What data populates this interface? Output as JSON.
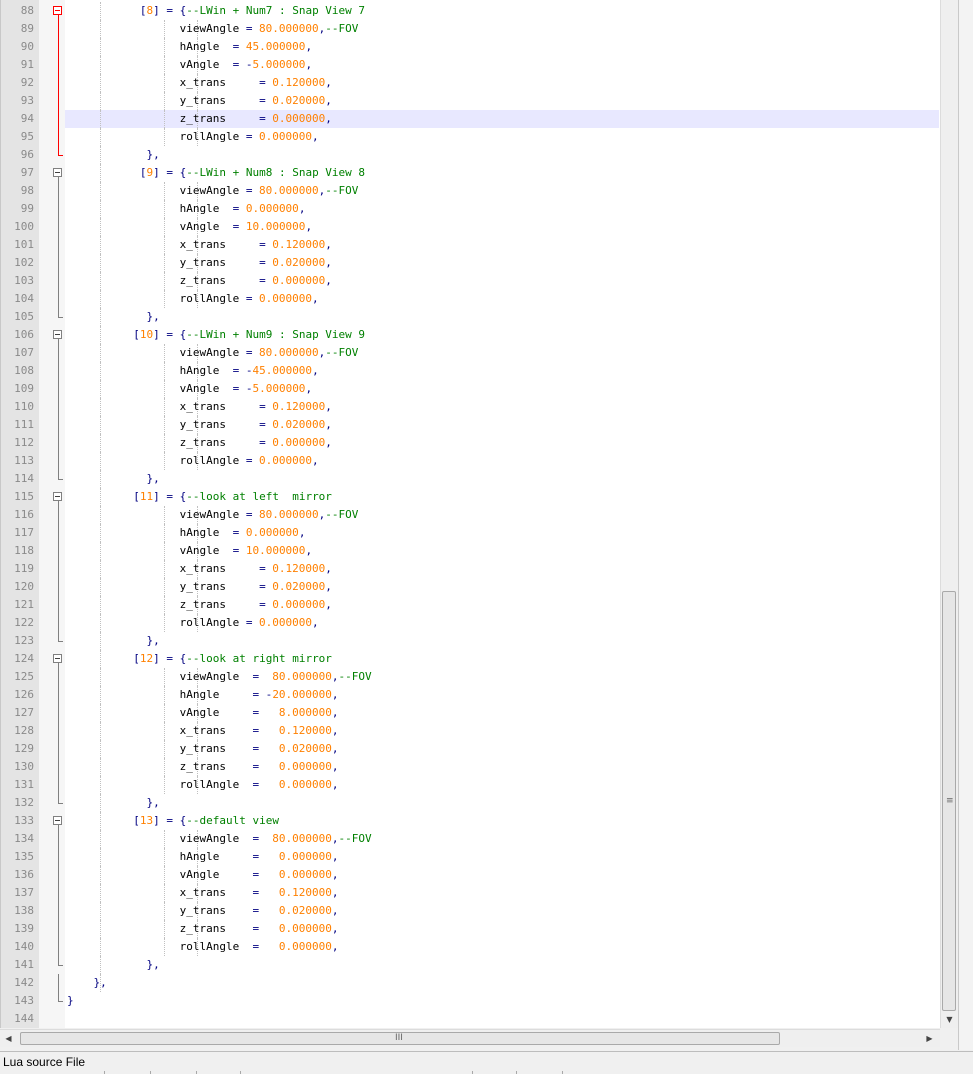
{
  "editor": {
    "current_line": 94,
    "lines": [
      {
        "num": "88",
        "fold": "box-red",
        "tokens": [
          [
            "",
            "          "
          ],
          [
            "k",
            " ["
          ],
          [
            "n",
            "8"
          ],
          [
            "k",
            "] = {"
          ],
          [
            "c",
            "--LWin + Num7 : Snap View 7"
          ]
        ]
      },
      {
        "num": "89",
        "fold": "line-red",
        "tokens": [
          [
            "",
            "                 viewAngle "
          ],
          [
            "k",
            "="
          ],
          [
            "n",
            " 80.000000"
          ],
          [
            "k",
            ","
          ],
          [
            "c",
            "--FOV"
          ]
        ]
      },
      {
        "num": "90",
        "fold": "line-red",
        "tokens": [
          [
            "",
            "                 hAngle  "
          ],
          [
            "k",
            "="
          ],
          [
            "n",
            " 45.000000"
          ],
          [
            "k",
            ","
          ]
        ]
      },
      {
        "num": "91",
        "fold": "line-red",
        "tokens": [
          [
            "",
            "                 vAngle  "
          ],
          [
            "k",
            "="
          ],
          [
            "k",
            " -"
          ],
          [
            "n",
            "5.000000"
          ],
          [
            "k",
            ","
          ]
        ]
      },
      {
        "num": "92",
        "fold": "line-red",
        "tokens": [
          [
            "",
            "                 x_trans     "
          ],
          [
            "k",
            "="
          ],
          [
            "n",
            " 0.120000"
          ],
          [
            "k",
            ","
          ]
        ]
      },
      {
        "num": "93",
        "fold": "line-red",
        "tokens": [
          [
            "",
            "                 y_trans     "
          ],
          [
            "k",
            "="
          ],
          [
            "n",
            " 0.020000"
          ],
          [
            "k",
            ","
          ]
        ]
      },
      {
        "num": "94",
        "fold": "line-red",
        "tokens": [
          [
            "",
            "                 z_trans     "
          ],
          [
            "k",
            "="
          ],
          [
            "n",
            " 0.000000"
          ],
          [
            "k",
            ","
          ]
        ]
      },
      {
        "num": "95",
        "fold": "line-red",
        "tokens": [
          [
            "",
            "                 rollAngle "
          ],
          [
            "k",
            "="
          ],
          [
            "n",
            " 0.000000"
          ],
          [
            "k",
            ","
          ]
        ]
      },
      {
        "num": "96",
        "fold": "end-red",
        "tokens": [
          [
            "k",
            "            },"
          ]
        ]
      },
      {
        "num": "97",
        "fold": "box",
        "tokens": [
          [
            "",
            "          "
          ],
          [
            "k",
            " ["
          ],
          [
            "n",
            "9"
          ],
          [
            "k",
            "] = {"
          ],
          [
            "c",
            "--LWin + Num8 : Snap View 8"
          ]
        ]
      },
      {
        "num": "98",
        "fold": "line",
        "tokens": [
          [
            "",
            "                 viewAngle "
          ],
          [
            "k",
            "="
          ],
          [
            "n",
            " 80.000000"
          ],
          [
            "k",
            ","
          ],
          [
            "c",
            "--FOV"
          ]
        ]
      },
      {
        "num": "99",
        "fold": "line",
        "tokens": [
          [
            "",
            "                 hAngle  "
          ],
          [
            "k",
            "="
          ],
          [
            "n",
            " 0.000000"
          ],
          [
            "k",
            ","
          ]
        ]
      },
      {
        "num": "100",
        "fold": "line",
        "tokens": [
          [
            "",
            "                 vAngle  "
          ],
          [
            "k",
            "="
          ],
          [
            "n",
            " 10.000000"
          ],
          [
            "k",
            ","
          ]
        ]
      },
      {
        "num": "101",
        "fold": "line",
        "tokens": [
          [
            "",
            "                 x_trans     "
          ],
          [
            "k",
            "="
          ],
          [
            "n",
            " 0.120000"
          ],
          [
            "k",
            ","
          ]
        ]
      },
      {
        "num": "102",
        "fold": "line",
        "tokens": [
          [
            "",
            "                 y_trans     "
          ],
          [
            "k",
            "="
          ],
          [
            "n",
            " 0.020000"
          ],
          [
            "k",
            ","
          ]
        ]
      },
      {
        "num": "103",
        "fold": "line",
        "tokens": [
          [
            "",
            "                 z_trans     "
          ],
          [
            "k",
            "="
          ],
          [
            "n",
            " 0.000000"
          ],
          [
            "k",
            ","
          ]
        ]
      },
      {
        "num": "104",
        "fold": "line",
        "tokens": [
          [
            "",
            "                 rollAngle "
          ],
          [
            "k",
            "="
          ],
          [
            "n",
            " 0.000000"
          ],
          [
            "k",
            ","
          ]
        ]
      },
      {
        "num": "105",
        "fold": "end",
        "tokens": [
          [
            "k",
            "            },"
          ]
        ]
      },
      {
        "num": "106",
        "fold": "box",
        "tokens": [
          [
            "",
            "          "
          ],
          [
            "k",
            "["
          ],
          [
            "n",
            "10"
          ],
          [
            "k",
            "] = {"
          ],
          [
            "c",
            "--LWin + Num9 : Snap View 9"
          ]
        ]
      },
      {
        "num": "107",
        "fold": "line",
        "tokens": [
          [
            "",
            "                 viewAngle "
          ],
          [
            "k",
            "="
          ],
          [
            "n",
            " 80.000000"
          ],
          [
            "k",
            ","
          ],
          [
            "c",
            "--FOV"
          ]
        ]
      },
      {
        "num": "108",
        "fold": "line",
        "tokens": [
          [
            "",
            "                 hAngle  "
          ],
          [
            "k",
            "="
          ],
          [
            "k",
            " -"
          ],
          [
            "n",
            "45.000000"
          ],
          [
            "k",
            ","
          ]
        ]
      },
      {
        "num": "109",
        "fold": "line",
        "tokens": [
          [
            "",
            "                 vAngle  "
          ],
          [
            "k",
            "="
          ],
          [
            "k",
            " -"
          ],
          [
            "n",
            "5.000000"
          ],
          [
            "k",
            ","
          ]
        ]
      },
      {
        "num": "110",
        "fold": "line",
        "tokens": [
          [
            "",
            "                 x_trans     "
          ],
          [
            "k",
            "="
          ],
          [
            "n",
            " 0.120000"
          ],
          [
            "k",
            ","
          ]
        ]
      },
      {
        "num": "111",
        "fold": "line",
        "tokens": [
          [
            "",
            "                 y_trans     "
          ],
          [
            "k",
            "="
          ],
          [
            "n",
            " 0.020000"
          ],
          [
            "k",
            ","
          ]
        ]
      },
      {
        "num": "112",
        "fold": "line",
        "tokens": [
          [
            "",
            "                 z_trans     "
          ],
          [
            "k",
            "="
          ],
          [
            "n",
            " 0.000000"
          ],
          [
            "k",
            ","
          ]
        ]
      },
      {
        "num": "113",
        "fold": "line",
        "tokens": [
          [
            "",
            "                 rollAngle "
          ],
          [
            "k",
            "="
          ],
          [
            "n",
            " 0.000000"
          ],
          [
            "k",
            ","
          ]
        ]
      },
      {
        "num": "114",
        "fold": "end",
        "tokens": [
          [
            "k",
            "            },"
          ]
        ]
      },
      {
        "num": "115",
        "fold": "box",
        "tokens": [
          [
            "",
            "          "
          ],
          [
            "k",
            "["
          ],
          [
            "n",
            "11"
          ],
          [
            "k",
            "] = {"
          ],
          [
            "c",
            "--look at left  mirror"
          ]
        ]
      },
      {
        "num": "116",
        "fold": "line",
        "tokens": [
          [
            "",
            "                 viewAngle "
          ],
          [
            "k",
            "="
          ],
          [
            "n",
            " 80.000000"
          ],
          [
            "k",
            ","
          ],
          [
            "c",
            "--FOV"
          ]
        ]
      },
      {
        "num": "117",
        "fold": "line",
        "tokens": [
          [
            "",
            "                 hAngle  "
          ],
          [
            "k",
            "="
          ],
          [
            "n",
            " 0.000000"
          ],
          [
            "k",
            ","
          ]
        ]
      },
      {
        "num": "118",
        "fold": "line",
        "tokens": [
          [
            "",
            "                 vAngle  "
          ],
          [
            "k",
            "="
          ],
          [
            "n",
            " 10.000000"
          ],
          [
            "k",
            ","
          ]
        ]
      },
      {
        "num": "119",
        "fold": "line",
        "tokens": [
          [
            "",
            "                 x_trans     "
          ],
          [
            "k",
            "="
          ],
          [
            "n",
            " 0.120000"
          ],
          [
            "k",
            ","
          ]
        ]
      },
      {
        "num": "120",
        "fold": "line",
        "tokens": [
          [
            "",
            "                 y_trans     "
          ],
          [
            "k",
            "="
          ],
          [
            "n",
            " 0.020000"
          ],
          [
            "k",
            ","
          ]
        ]
      },
      {
        "num": "121",
        "fold": "line",
        "tokens": [
          [
            "",
            "                 z_trans     "
          ],
          [
            "k",
            "="
          ],
          [
            "n",
            " 0.000000"
          ],
          [
            "k",
            ","
          ]
        ]
      },
      {
        "num": "122",
        "fold": "line",
        "tokens": [
          [
            "",
            "                 rollAngle "
          ],
          [
            "k",
            "="
          ],
          [
            "n",
            " 0.000000"
          ],
          [
            "k",
            ","
          ]
        ]
      },
      {
        "num": "123",
        "fold": "end",
        "tokens": [
          [
            "k",
            "            },"
          ]
        ]
      },
      {
        "num": "124",
        "fold": "box",
        "tokens": [
          [
            "",
            "          "
          ],
          [
            "k",
            "["
          ],
          [
            "n",
            "12"
          ],
          [
            "k",
            "] = {"
          ],
          [
            "c",
            "--look at right mirror"
          ]
        ]
      },
      {
        "num": "125",
        "fold": "line",
        "tokens": [
          [
            "",
            "                 viewAngle  "
          ],
          [
            "k",
            "="
          ],
          [
            "n",
            "  80.000000"
          ],
          [
            "k",
            ","
          ],
          [
            "c",
            "--FOV"
          ]
        ]
      },
      {
        "num": "126",
        "fold": "line",
        "tokens": [
          [
            "",
            "                 hAngle     "
          ],
          [
            "k",
            "="
          ],
          [
            "k",
            " -"
          ],
          [
            "n",
            "20.000000"
          ],
          [
            "k",
            ","
          ]
        ]
      },
      {
        "num": "127",
        "fold": "line",
        "tokens": [
          [
            "",
            "                 vAngle     "
          ],
          [
            "k",
            "="
          ],
          [
            "n",
            "   8.000000"
          ],
          [
            "k",
            ","
          ]
        ]
      },
      {
        "num": "128",
        "fold": "line",
        "tokens": [
          [
            "",
            "                 x_trans    "
          ],
          [
            "k",
            "="
          ],
          [
            "n",
            "   0.120000"
          ],
          [
            "k",
            ","
          ]
        ]
      },
      {
        "num": "129",
        "fold": "line",
        "tokens": [
          [
            "",
            "                 y_trans    "
          ],
          [
            "k",
            "="
          ],
          [
            "n",
            "   0.020000"
          ],
          [
            "k",
            ","
          ]
        ]
      },
      {
        "num": "130",
        "fold": "line",
        "tokens": [
          [
            "",
            "                 z_trans    "
          ],
          [
            "k",
            "="
          ],
          [
            "n",
            "   0.000000"
          ],
          [
            "k",
            ","
          ]
        ]
      },
      {
        "num": "131",
        "fold": "line",
        "tokens": [
          [
            "",
            "                 rollAngle  "
          ],
          [
            "k",
            "="
          ],
          [
            "n",
            "   0.000000"
          ],
          [
            "k",
            ","
          ]
        ]
      },
      {
        "num": "132",
        "fold": "end",
        "tokens": [
          [
            "k",
            "            },"
          ]
        ]
      },
      {
        "num": "133",
        "fold": "box",
        "tokens": [
          [
            "",
            "          "
          ],
          [
            "k",
            "["
          ],
          [
            "n",
            "13"
          ],
          [
            "k",
            "] = {"
          ],
          [
            "c",
            "--default view"
          ]
        ]
      },
      {
        "num": "134",
        "fold": "line",
        "tokens": [
          [
            "",
            "                 viewAngle  "
          ],
          [
            "k",
            "="
          ],
          [
            "n",
            "  80.000000"
          ],
          [
            "k",
            ","
          ],
          [
            "c",
            "--FOV"
          ]
        ]
      },
      {
        "num": "135",
        "fold": "line",
        "tokens": [
          [
            "",
            "                 hAngle     "
          ],
          [
            "k",
            "="
          ],
          [
            "n",
            "   0.000000"
          ],
          [
            "k",
            ","
          ]
        ]
      },
      {
        "num": "136",
        "fold": "line",
        "tokens": [
          [
            "",
            "                 vAngle     "
          ],
          [
            "k",
            "="
          ],
          [
            "n",
            "   0.000000"
          ],
          [
            "k",
            ","
          ]
        ]
      },
      {
        "num": "137",
        "fold": "line",
        "tokens": [
          [
            "",
            "                 x_trans    "
          ],
          [
            "k",
            "="
          ],
          [
            "n",
            "   0.120000"
          ],
          [
            "k",
            ","
          ]
        ]
      },
      {
        "num": "138",
        "fold": "line",
        "tokens": [
          [
            "",
            "                 y_trans    "
          ],
          [
            "k",
            "="
          ],
          [
            "n",
            "   0.020000"
          ],
          [
            "k",
            ","
          ]
        ]
      },
      {
        "num": "139",
        "fold": "line",
        "tokens": [
          [
            "",
            "                 z_trans    "
          ],
          [
            "k",
            "="
          ],
          [
            "n",
            "   0.000000"
          ],
          [
            "k",
            ","
          ]
        ]
      },
      {
        "num": "140",
        "fold": "line",
        "tokens": [
          [
            "",
            "                 rollAngle  "
          ],
          [
            "k",
            "="
          ],
          [
            "n",
            "   0.000000"
          ],
          [
            "k",
            ","
          ]
        ]
      },
      {
        "num": "141",
        "fold": "end",
        "tokens": [
          [
            "k",
            "            },"
          ]
        ]
      },
      {
        "num": "142",
        "fold": "line",
        "tokens": [
          [
            "k",
            "    },"
          ]
        ]
      },
      {
        "num": "143",
        "fold": "end",
        "tokens": [
          [
            "k",
            "}"
          ]
        ]
      },
      {
        "num": "144",
        "fold": "none",
        "tokens": []
      }
    ]
  },
  "scrollbars": {
    "vertical_grip": "≡",
    "vertical_down": "▼",
    "horizontal_left": "◀",
    "horizontal_right": "▶",
    "horizontal_grip": "III"
  },
  "statusbar": {
    "doc_type": "Lua source File"
  }
}
